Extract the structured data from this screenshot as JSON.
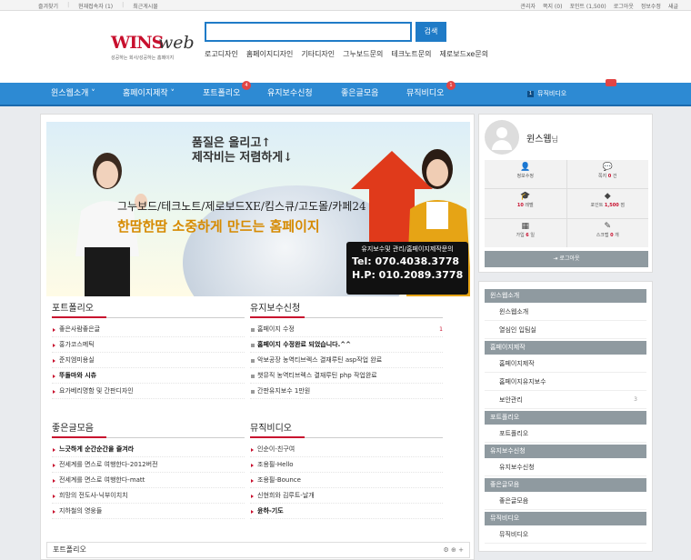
{
  "topbar": {
    "left": [
      "즐겨찾기",
      "현재접속자 (1)",
      "최근게시물"
    ],
    "right": [
      "관리자",
      "쪽지 (0)",
      "포인트 (1,500)",
      "로그아웃",
      "정보수정",
      "새글"
    ]
  },
  "header": {
    "logo_red": "WINS",
    "logo_dark": "web",
    "logo_slogan": "성공하는 회사/성공하는 홈페이지",
    "search_placeholder": "",
    "search_button": "검색",
    "quick_links": [
      "로고디자인",
      "홈페이지디자인",
      "기타디자인",
      "그누보드문의",
      "테크노트문의",
      "제로보드xe문의"
    ]
  },
  "nav": {
    "items": [
      {
        "label": "윈스웹소개 ˅",
        "badge": ""
      },
      {
        "label": "홈페이지제작 ˅",
        "badge": ""
      },
      {
        "label": "포트폴리오",
        "badge": "4"
      },
      {
        "label": "유지보수신청",
        "badge": ""
      },
      {
        "label": "좋은글모음",
        "badge": ""
      },
      {
        "label": "뮤직비디오",
        "badge": "1"
      }
    ],
    "mv_num": "1",
    "mv_label": "뮤직비디오"
  },
  "banner": {
    "line1": "품질은 올리고↑",
    "line2": "제작비는 저렴하게↓",
    "line3": "그누보드/테크노트/제로보드XE/킴스큐/고도몰/카페24",
    "line4": "한땀한땀 소중하게 만드는 홈페이지",
    "contact_title": "유지보수및 관리/홈페이지제작문의",
    "tel": "Tel: 070.4038.3778",
    "hp": "H.P: 010.2089.3778"
  },
  "boxes": [
    {
      "title": "포트폴리오",
      "items": [
        {
          "text": "좋은사람좋은글",
          "bold": false,
          "count": ""
        },
        {
          "text": "홍가코스메틱",
          "bold": false,
          "count": ""
        },
        {
          "text": "준지엠미용실",
          "bold": false,
          "count": ""
        },
        {
          "text": "뚜돌마와 시츄",
          "bold": true,
          "count": ""
        },
        {
          "text": "요가베리명함 및 간판디자인",
          "bold": false,
          "count": ""
        }
      ]
    },
    {
      "title": "유지보수신청",
      "items": [
        {
          "text": "홈페이지 수정",
          "bold": false,
          "count": "1"
        },
        {
          "text": "홈페이지 수정완료 되었습니다.^^",
          "bold": true,
          "count": ""
        },
        {
          "text": "악보공장 농역티브렉스 결재루틴 asp작업 완료",
          "bold": false,
          "count": ""
        },
        {
          "text": "챗뮤직 농역티브렉스 결재루틴 php 작업완료",
          "bold": false,
          "count": ""
        },
        {
          "text": "간판유지보수 1만원",
          "bold": false,
          "count": ""
        }
      ]
    },
    {
      "title": "좋은글모음",
      "items": [
        {
          "text": "느긋하게 순간순간을 즐겨라",
          "bold": true,
          "count": ""
        },
        {
          "text": "전세계를 면스로 여행한다-2012버전",
          "bold": false,
          "count": ""
        },
        {
          "text": "전세계를 면스로 여행한다-matt",
          "bold": false,
          "count": ""
        },
        {
          "text": "희망의 전도사-닉부이치치",
          "bold": false,
          "count": ""
        },
        {
          "text": "지하철의 영웅들",
          "bold": false,
          "count": ""
        }
      ]
    },
    {
      "title": "뮤직비디오",
      "items": [
        {
          "text": "인순이-친구여",
          "bold": false,
          "count": ""
        },
        {
          "text": "조용필-Hello",
          "bold": false,
          "count": ""
        },
        {
          "text": "조용필-Bounce",
          "bold": false,
          "count": ""
        },
        {
          "text": "신현희와 김루트-날개",
          "bold": false,
          "count": ""
        },
        {
          "text": "윤하-기도",
          "bold": true,
          "count": ""
        }
      ]
    }
  ],
  "bottom_section": {
    "title": "포트폴리오",
    "icons": "⚙ ⊕ +"
  },
  "profile": {
    "name": "윈스웹",
    "suffix": "님",
    "cells": [
      {
        "icon": "👤",
        "label": "정보수정",
        "value": ""
      },
      {
        "icon": "💬",
        "label": "쪽지 ",
        "value": "0",
        "unit": " 건"
      },
      {
        "icon": "🎓",
        "label": "",
        "value": "10",
        "unit": " 레벨"
      },
      {
        "icon": "◆",
        "label": "포인트 ",
        "value": "1,500",
        "unit": " 점"
      },
      {
        "icon": "▦",
        "label": "가입 ",
        "value": "6",
        "unit": " 일"
      },
      {
        "icon": "✎",
        "label": "스크랩 ",
        "value": "0",
        "unit": " 개"
      }
    ],
    "logout": "⇥ 로그아웃"
  },
  "sidebar": [
    {
      "group": "윈스웹소개",
      "subs": [
        {
          "label": "윈스웹소개",
          "count": ""
        },
        {
          "label": "열심인 입팀실",
          "count": ""
        }
      ]
    },
    {
      "group": "홈페이지제작",
      "subs": [
        {
          "label": "홈페이지제작",
          "count": ""
        },
        {
          "label": "홈페이지유지보수",
          "count": ""
        },
        {
          "label": "보안관리",
          "count": "3"
        }
      ]
    },
    {
      "group": "포트폴리오",
      "subs": [
        {
          "label": "포트폴리오",
          "count": ""
        }
      ]
    },
    {
      "group": "유지보수신청",
      "subs": [
        {
          "label": "유지보수신청",
          "count": ""
        }
      ]
    },
    {
      "group": "좋은글모음",
      "subs": [
        {
          "label": "좋은글모음",
          "count": ""
        }
      ]
    },
    {
      "group": "뮤직비디오",
      "subs": [
        {
          "label": "뮤직비디오",
          "count": ""
        }
      ]
    }
  ],
  "colors": {
    "nav": "#2d8ad3",
    "accent": "#c8102e",
    "side_group": "#8f9aa0"
  }
}
